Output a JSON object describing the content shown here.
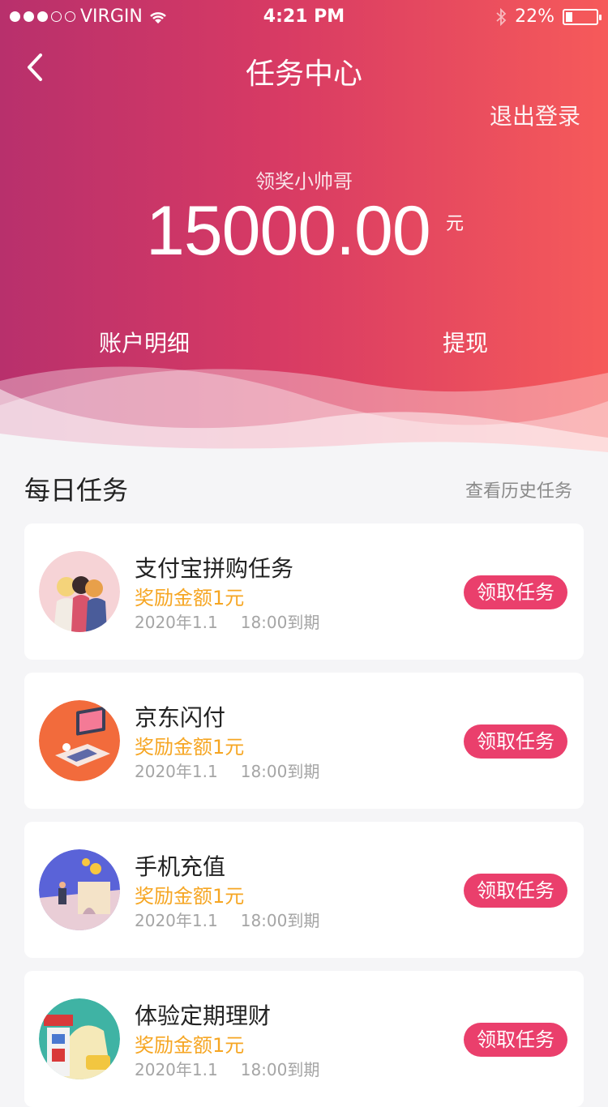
{
  "status_bar": {
    "carrier": "VIRGIN",
    "time": "4:21 PM",
    "battery": "22%"
  },
  "nav": {
    "title": "任务中心",
    "logout": "退出登录"
  },
  "account": {
    "nickname": "领奖小帅哥",
    "amount": "15000.00",
    "unit": "元"
  },
  "actions": {
    "detail": "账户明细",
    "withdraw": "提现"
  },
  "section": {
    "title": "每日任务",
    "history": "查看历史任务"
  },
  "tasks": [
    {
      "name": "支付宝拼购任务",
      "reward": "奖励金额1元",
      "date": "2020年1.1",
      "deadline": "18:00到期",
      "button": "领取任务"
    },
    {
      "name": "京东闪付",
      "reward": "奖励金额1元",
      "date": "2020年1.1",
      "deadline": "18:00到期",
      "button": "领取任务"
    },
    {
      "name": "手机充值",
      "reward": "奖励金额1元",
      "date": "2020年1.1",
      "deadline": "18:00到期",
      "button": "领取任务"
    },
    {
      "name": "体验定期理财",
      "reward": "奖励金额1元",
      "date": "2020年1.1",
      "deadline": "18:00到期",
      "button": "领取任务"
    }
  ],
  "colors": {
    "accent": "#ea3f6c",
    "reward": "#f6a623",
    "gradient_start": "#b8306c",
    "gradient_end": "#f65a5a"
  }
}
